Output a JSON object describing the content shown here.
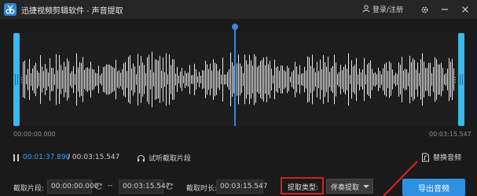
{
  "titlebar": {
    "app_name": "迅捷视频剪辑软件",
    "separator": "-",
    "section": "声音提取",
    "login": "登录/注册",
    "icons": [
      "app-logo",
      "user-icon",
      "settings-icon",
      "minimize-icon",
      "close-icon"
    ]
  },
  "waveform": {
    "start_time": "00:00:00.000",
    "end_time": "00:03:15.547",
    "playhead_fraction": 0.49,
    "wave_color": "#e8e8e8",
    "handle_color": "#3bb9ea",
    "playhead_color": "#3b84e0"
  },
  "playback": {
    "current": "00:01:37.890",
    "total": "/ 00:03:15.547",
    "preview_label": "试听截取片段"
  },
  "replace_audio_label": "替换音频",
  "clip": {
    "segment_label": "截取片段:",
    "start": "00:00:00.000",
    "dash": "--",
    "end": "00:03:15.547",
    "duration_label": "截取时长:",
    "duration": "00:03:15.547"
  },
  "extract": {
    "type_label": "提取类型:",
    "type_value": "伴奏提取",
    "highlight_color": "#d2231f"
  },
  "export_label": "导出音频",
  "accent_color": "#2c8fe0"
}
